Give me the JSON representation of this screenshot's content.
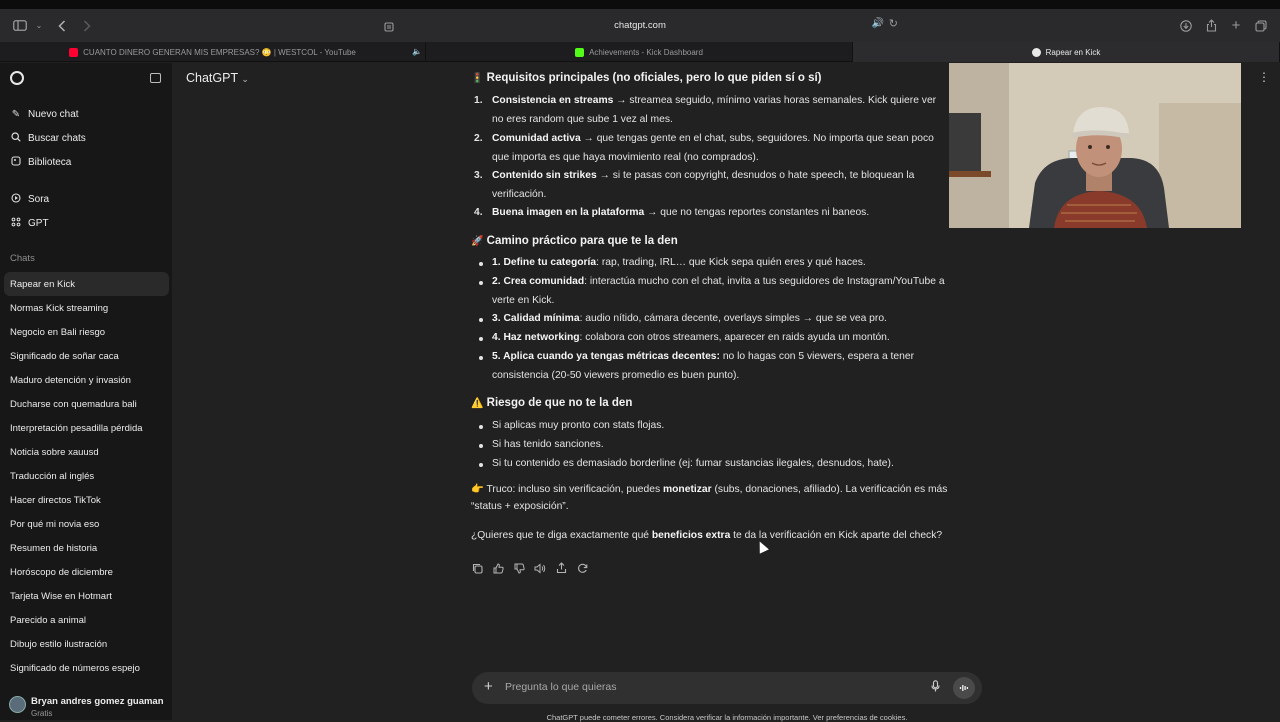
{
  "browser": {
    "url": "chatgpt.com",
    "tabs": [
      {
        "label": "CUANTO DINERO GENERAN MIS EMPRESAS? 😳 | WESTCOL - YouTube",
        "active": false,
        "favicon_color": "#ff0033"
      },
      {
        "label": "Achievements - Kick Dashboard",
        "active": false,
        "favicon_color": "#53fc18"
      },
      {
        "label": "Rapear en Kick",
        "active": true,
        "favicon_color": "#e8e8e8"
      }
    ]
  },
  "sidebar": {
    "actions": [
      {
        "icon": "edit-icon",
        "label": "Nuevo chat"
      },
      {
        "icon": "search-icon",
        "label": "Buscar chats"
      },
      {
        "icon": "library-icon",
        "label": "Biblioteca"
      },
      {
        "icon": "sora-icon",
        "label": "Sora"
      },
      {
        "icon": "gpt-grid-icon",
        "label": "GPT"
      }
    ],
    "chats_heading": "Chats",
    "chats": [
      "Rapear en Kick",
      "Normas Kick streaming",
      "Negocio en Bali riesgo",
      "Significado de soñar caca",
      "Maduro detención y invasión",
      "Ducharse con quemadura bali",
      "Interpretación pesadilla pérdida",
      "Noticia sobre xauusd",
      "Traducción al inglés",
      "Hacer directos TikTok",
      "Por qué mi novia eso",
      "Resumen de historia",
      "Horóscopo de diciembre",
      "Tarjeta Wise en Hotmart",
      "Parecido a animal",
      "Dibujo estilo ilustración",
      "Significado de números espejo"
    ],
    "user": {
      "name": "Bryan andres gomez guaman",
      "plan": "Gratis"
    }
  },
  "header": {
    "model": "ChatGPT"
  },
  "message": {
    "s1_title": "Requisitos principales (no oficiales, pero lo que piden sí o sí)",
    "s1_items": [
      {
        "n": "1.",
        "strong": "Consistencia en streams",
        "l1": " → streamea seguido, mínimo varias horas semanales. Kick quiere ver",
        "l2": "no eres random que sube 1 vez al mes."
      },
      {
        "n": "2.",
        "strong": "Comunidad activa",
        "l1": " → que tengas gente en el chat, subs, seguidores. No importa que sean poco",
        "l2": "que importa es que haya movimiento real (no comprados)."
      },
      {
        "n": "3.",
        "strong": "Contenido sin strikes",
        "l1": " → si te pasas con copyright, desnudos o hate speech, te bloquean la",
        "l2": "verificación."
      },
      {
        "n": "4.",
        "strong": "Buena imagen en la plataforma",
        "l1": " → que no tengas reportes constantes ni baneos.",
        "l2": ""
      }
    ],
    "s2_title": "Camino práctico para que te la den",
    "s2_items": [
      {
        "strong": "1. Define tu categoría",
        "l1": ": rap, trading, IRL… que Kick sepa quién eres y qué haces.",
        "l2": ""
      },
      {
        "strong": "2. Crea comunidad",
        "l1": ": interactúa mucho con el chat, invita a tus seguidores de Instagram/YouTube a",
        "l2": "verte en Kick."
      },
      {
        "strong": "3. Calidad mínima",
        "l1": ": audio nítido, cámara decente, overlays simples → que se vea pro.",
        "l2": ""
      },
      {
        "strong": "4. Haz networking",
        "l1": ": colabora con otros streamers, aparecer en raids ayuda un montón.",
        "l2": ""
      },
      {
        "strong": "5. Aplica cuando ya tengas métricas decentes:",
        "l1": " no lo hagas con 5 viewers, espera a tener",
        "l2": "consistencia (20-50 viewers promedio es buen punto)."
      }
    ],
    "s3_title": "Riesgo de que no te la den",
    "s3_items": [
      "Si aplicas muy pronto con stats flojas.",
      "Si has tenido sanciones.",
      "Si tu contenido es demasiado borderline (ej: fumar sustancias ilegales, desnudos, hate)."
    ],
    "tip": {
      "a": "Truco: incluso sin verificación, puedes ",
      "strong": "monetizar",
      "b": " (subs, donaciones, afiliado). La verificación es más",
      "c": "“status + exposición”."
    },
    "question": {
      "a": "¿Quieres que te diga exactamente qué ",
      "strong": "beneficios extra",
      "b": " te da la verificación en Kick aparte del check?"
    }
  },
  "composer": {
    "placeholder": "Pregunta lo que quieras"
  },
  "disclaimer": "ChatGPT puede cometer errores. Considera verificar la información importante. Ver preferencias de cookies."
}
